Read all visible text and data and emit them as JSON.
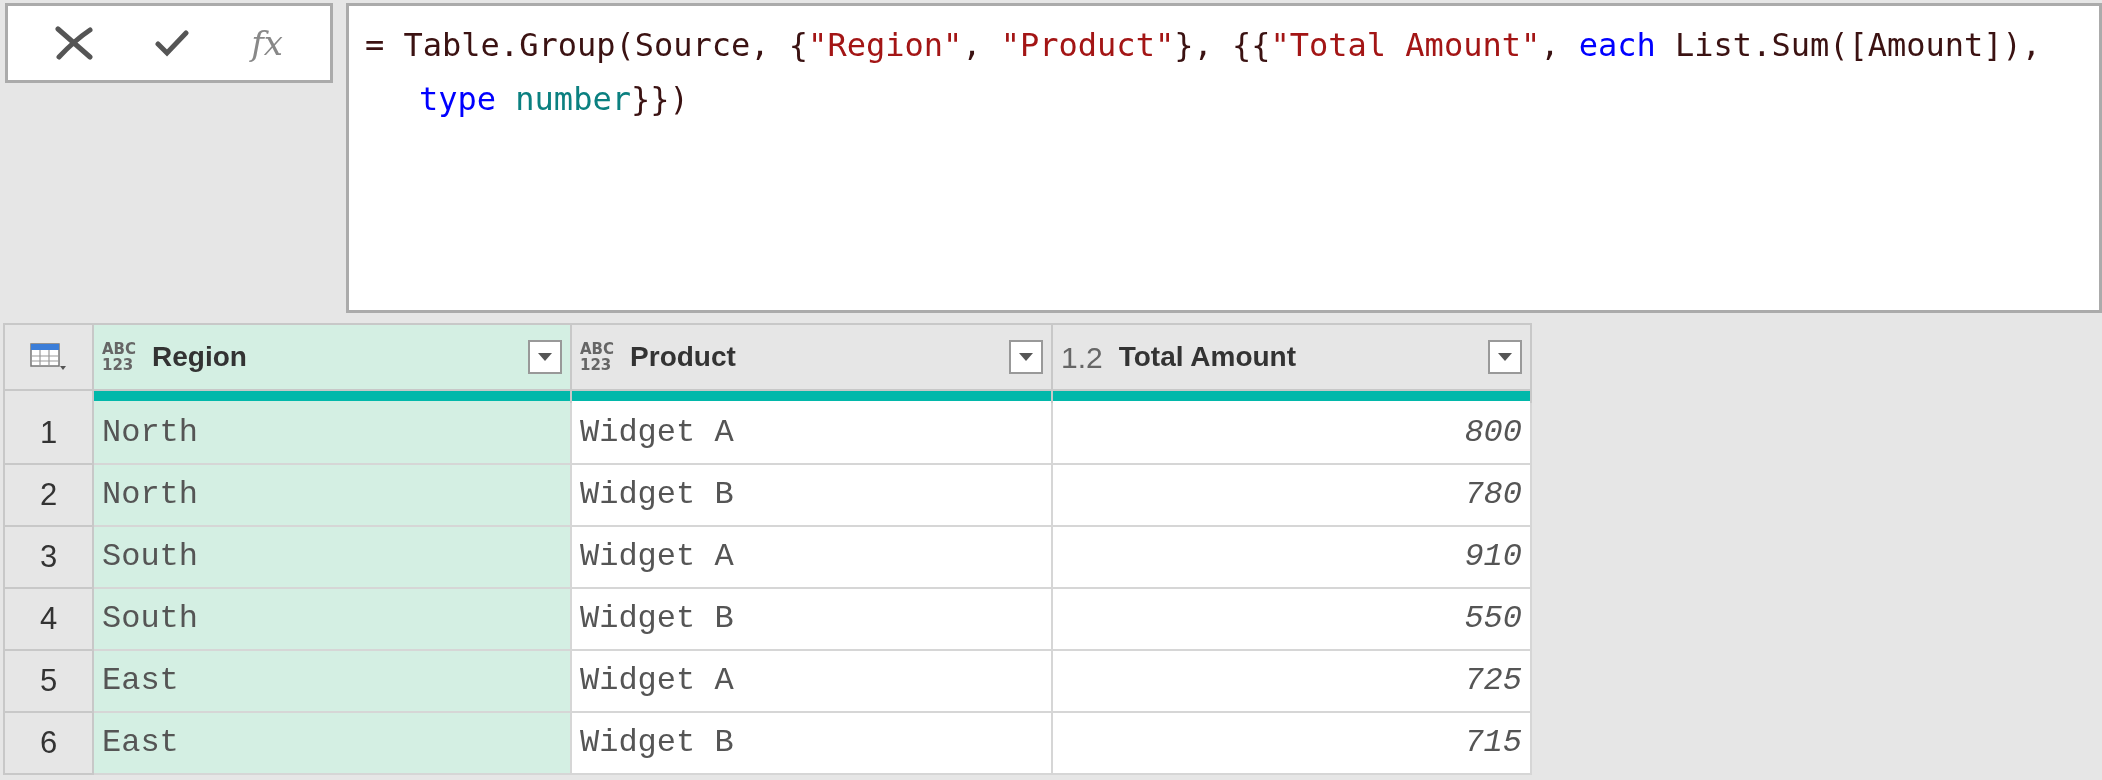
{
  "formula_bar": {
    "fx_label": "fx",
    "lines": [
      [
        {
          "text": "= Table.Group(Source, {",
          "kind": "plain"
        },
        {
          "text": "\"Region\"",
          "kind": "string"
        },
        {
          "text": ", ",
          "kind": "plain"
        },
        {
          "text": "\"Product\"",
          "kind": "string"
        },
        {
          "text": "}, {{",
          "kind": "plain"
        },
        {
          "text": "\"Total Amount\"",
          "kind": "string"
        },
        {
          "text": ", ",
          "kind": "plain"
        },
        {
          "text": "each",
          "kind": "keyword"
        },
        {
          "text": " List.Sum([Amount]),",
          "kind": "plain"
        }
      ],
      [
        {
          "text": "type",
          "kind": "keyword"
        },
        {
          "text": " number",
          "kind": "type"
        },
        {
          "text": "}})",
          "kind": "plain"
        }
      ]
    ]
  },
  "table": {
    "columns": [
      {
        "name": "Region",
        "type_labels": [
          "ABC",
          "123"
        ],
        "selected": true
      },
      {
        "name": "Product",
        "type_labels": [
          "ABC",
          "123"
        ],
        "selected": false
      },
      {
        "name": "Total Amount",
        "type_labels": [
          "1.2"
        ],
        "selected": false
      }
    ],
    "rows": [
      {
        "number": "1",
        "cells": [
          "North",
          "Widget A",
          "800"
        ]
      },
      {
        "number": "2",
        "cells": [
          "North",
          "Widget B",
          "780"
        ]
      },
      {
        "number": "3",
        "cells": [
          "South",
          "Widget A",
          "910"
        ]
      },
      {
        "number": "4",
        "cells": [
          "South",
          "Widget B",
          "550"
        ]
      },
      {
        "number": "5",
        "cells": [
          "East",
          "Widget A",
          "725"
        ]
      },
      {
        "number": "6",
        "cells": [
          "East",
          "Widget B",
          "715"
        ]
      }
    ]
  }
}
